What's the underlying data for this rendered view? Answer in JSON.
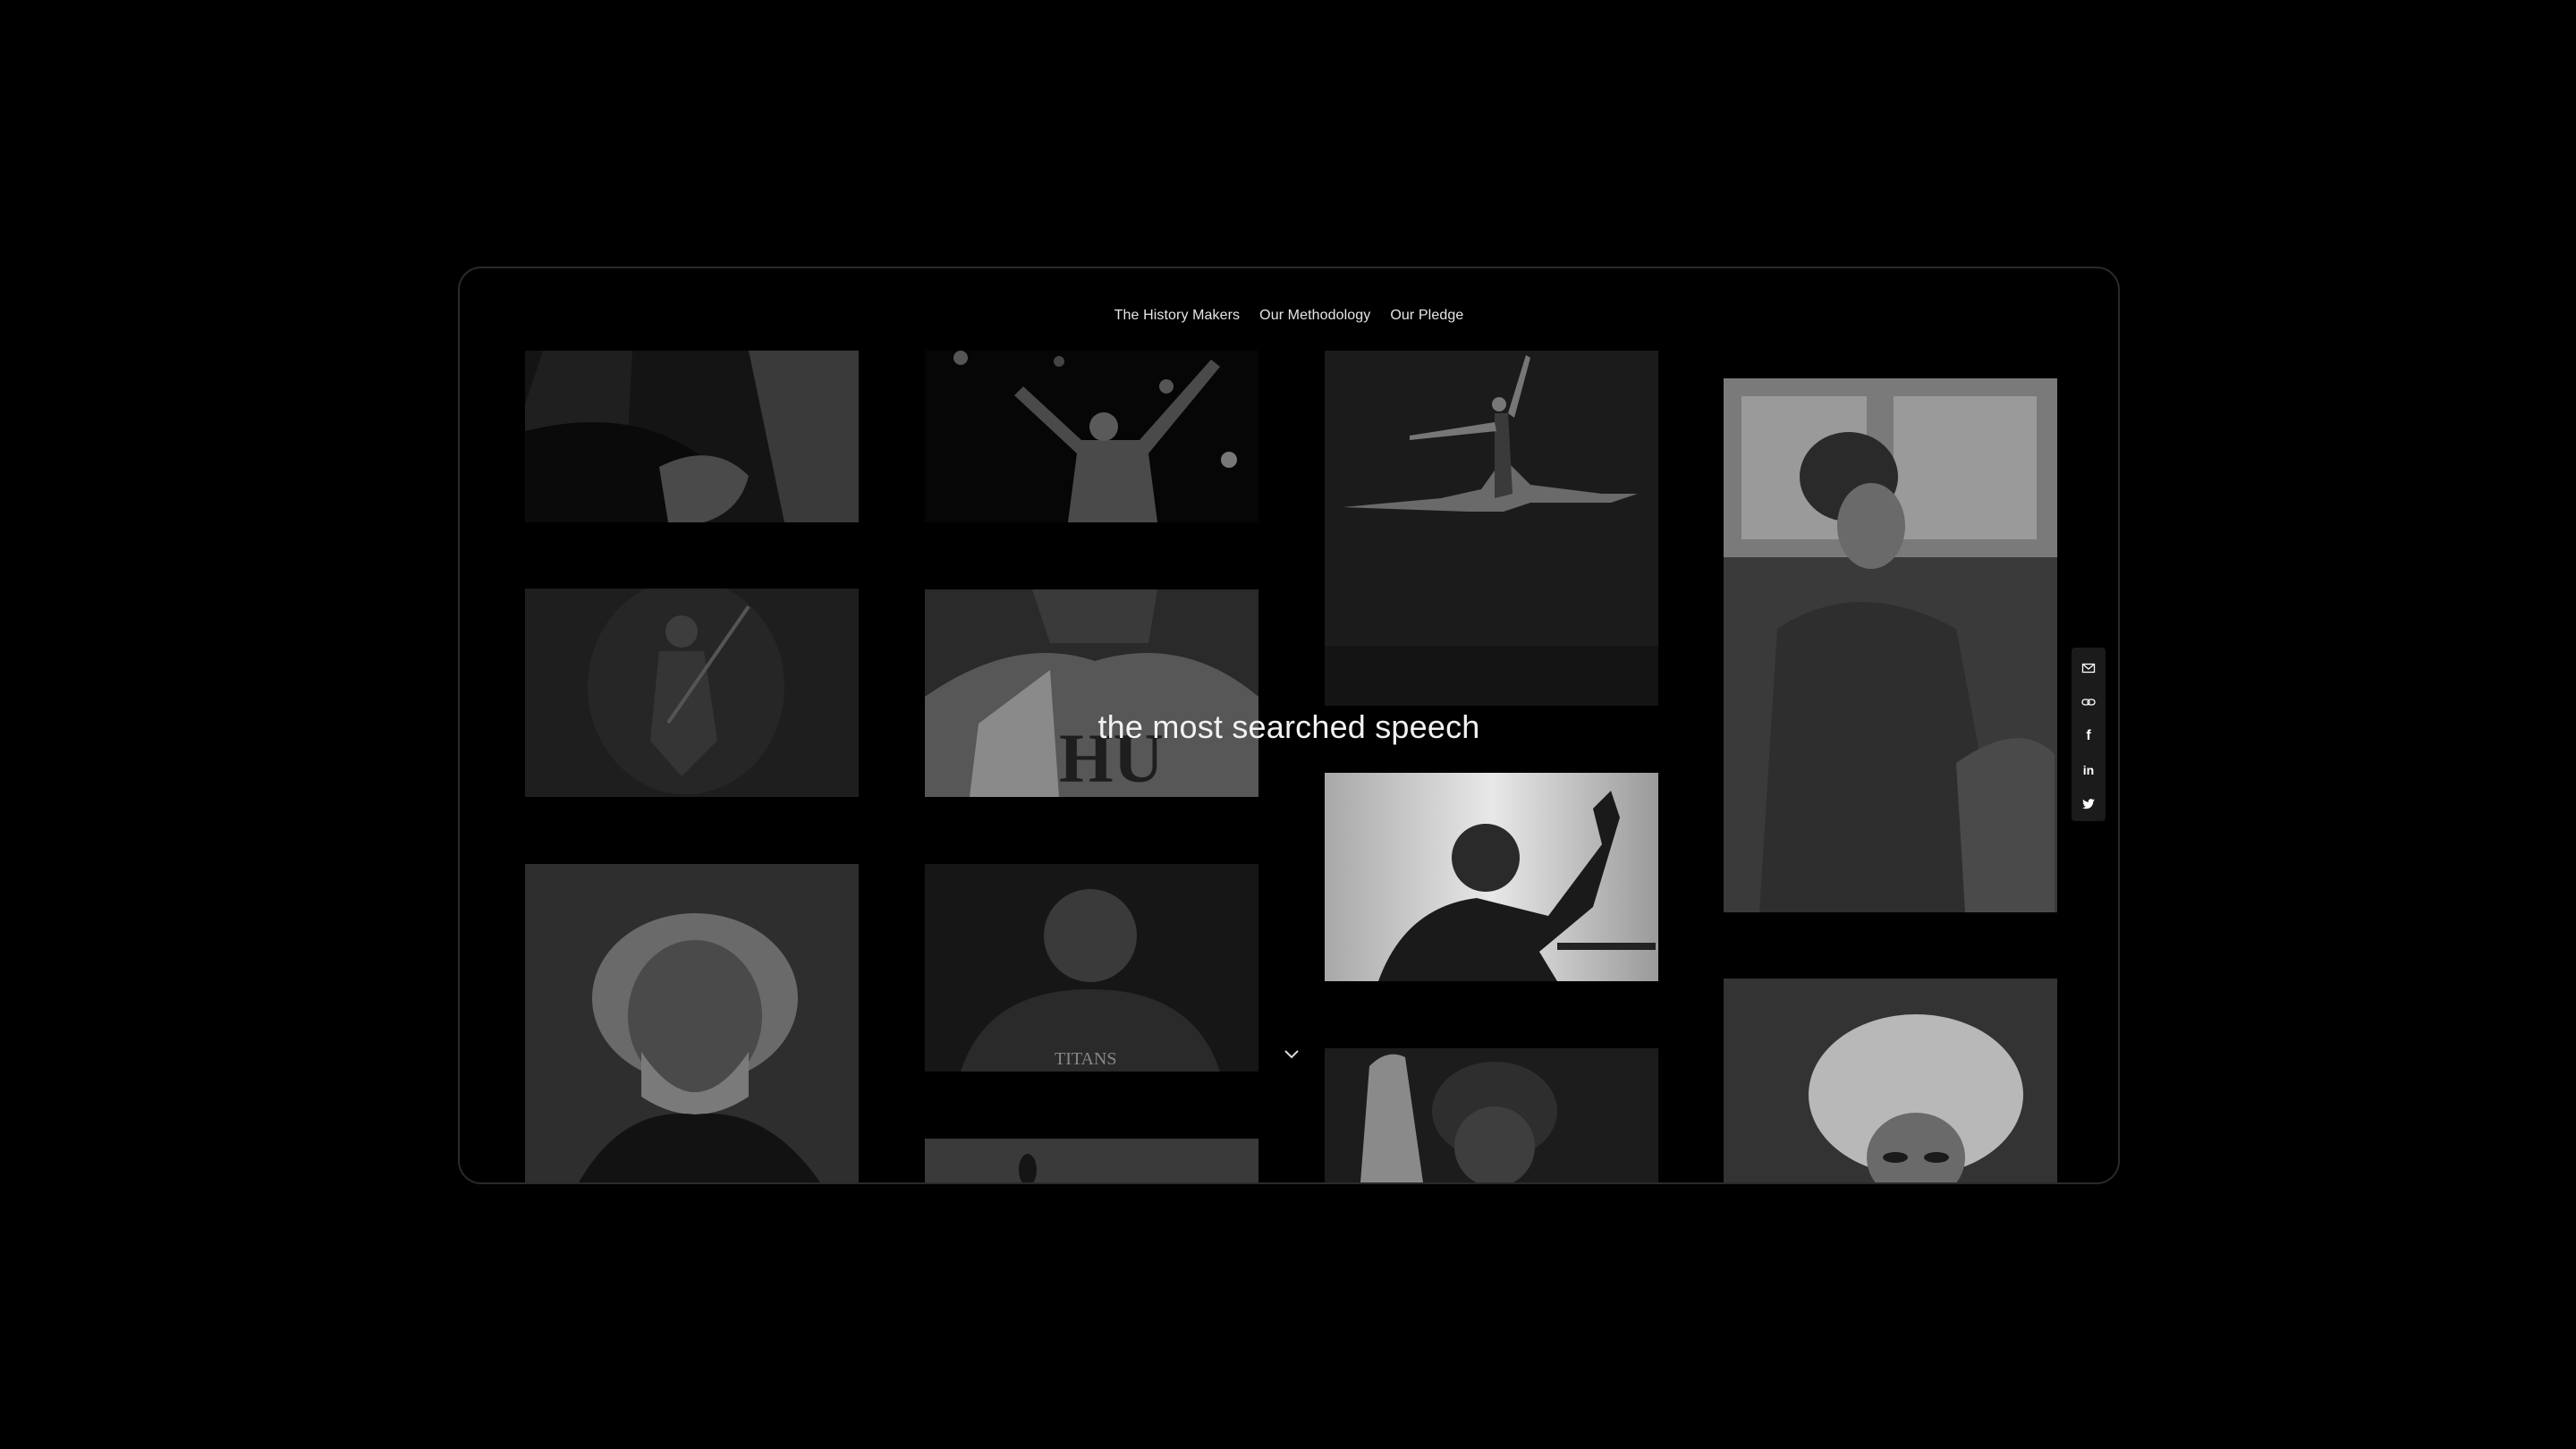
{
  "nav": {
    "items": [
      {
        "label": "The History Makers"
      },
      {
        "label": "Our Methodology"
      },
      {
        "label": "Our Pledge"
      }
    ]
  },
  "headline": "the most searched speech",
  "share": {
    "items": [
      {
        "icon": "email-icon"
      },
      {
        "icon": "link-icon"
      },
      {
        "icon": "facebook-icon",
        "glyph": "f"
      },
      {
        "icon": "linkedin-icon",
        "glyph": "in"
      },
      {
        "icon": "twitter-icon"
      }
    ]
  },
  "photos": [
    {
      "subject": "musician-hands"
    },
    {
      "subject": "gymnast"
    },
    {
      "subject": "ballet-dancer"
    },
    {
      "subject": "woman-on-bus"
    },
    {
      "subject": "guitarist-on-stage"
    },
    {
      "subject": "marching-band-member"
    },
    {
      "subject": "speaker-at-podium"
    },
    {
      "subject": "bearded-elder-portrait"
    },
    {
      "subject": "football-player"
    },
    {
      "subject": "woman-raised-fist"
    },
    {
      "subject": "drag-performer"
    },
    {
      "subject": "raised-hand"
    }
  ],
  "colors": {
    "background": "#000000",
    "frame_border": "#2a2a2a",
    "text": "#f2f2f2",
    "share_bg": "#1b1b1b"
  }
}
